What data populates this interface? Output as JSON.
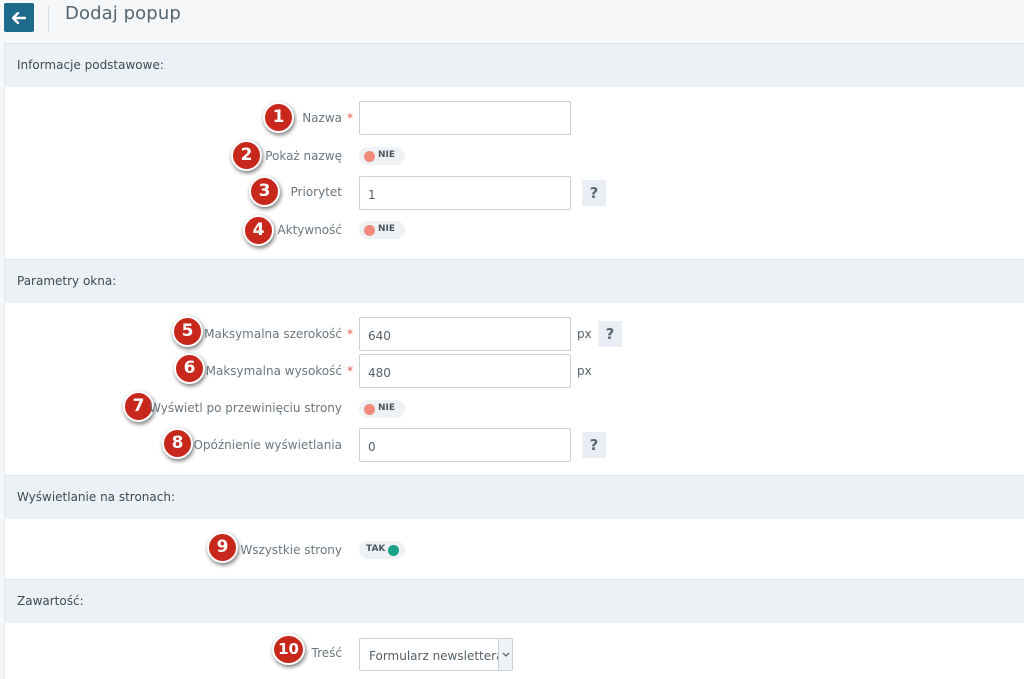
{
  "header": {
    "title": "Dodaj popup"
  },
  "sections": {
    "basic": {
      "title": "Informacje podstawowe:"
    },
    "window": {
      "title": "Parametry okna:"
    },
    "pages": {
      "title": "Wyświetlanie na stronach:"
    },
    "content": {
      "title": "Zawartość:"
    }
  },
  "fields": {
    "name": {
      "label": "Nazwa",
      "value": "",
      "required": "*"
    },
    "show_name": {
      "label": "Pokaż nazwę",
      "state": "NIE"
    },
    "priority": {
      "label": "Priorytet",
      "value": "1",
      "help": "?"
    },
    "active": {
      "label": "Aktywność",
      "state": "NIE"
    },
    "max_width": {
      "label": "Maksymalna szerokość",
      "value": "640",
      "unit": "px",
      "required": "*",
      "help": "?"
    },
    "max_height": {
      "label": "Maksymalna wysokość",
      "value": "480",
      "unit": "px",
      "required": "*"
    },
    "show_on_scroll": {
      "label": "Wyświetl po przewinięciu strony",
      "state": "NIE"
    },
    "display_delay": {
      "label": "Opóźnienie wyświetlania",
      "value": "0",
      "help": "?"
    },
    "all_pages": {
      "label": "Wszystkie strony",
      "state": "TAK"
    },
    "body": {
      "label": "Treść",
      "selected": "Formularz newslettera"
    }
  },
  "callouts": [
    "1",
    "2",
    "3",
    "4",
    "5",
    "6",
    "7",
    "8",
    "9",
    "10"
  ],
  "colors": {
    "accent": "#1e6a8d",
    "callout": "#c8271c",
    "toggle_off": "#f28b7b",
    "toggle_on": "#17a386",
    "required": "#e2574c"
  }
}
